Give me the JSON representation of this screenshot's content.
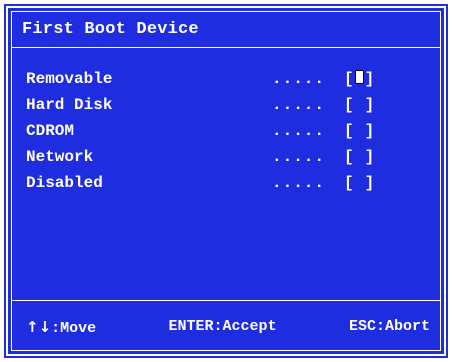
{
  "dialog": {
    "title": "First Boot Device"
  },
  "options": [
    {
      "label": "Removable",
      "dots": ".....",
      "selected": true
    },
    {
      "label": "Hard Disk",
      "dots": ".....",
      "selected": false
    },
    {
      "label": "CDROM",
      "dots": ".....",
      "selected": false
    },
    {
      "label": "Network",
      "dots": ".....",
      "selected": false
    },
    {
      "label": "Disabled",
      "dots": ".....",
      "selected": false
    }
  ],
  "footer": {
    "move_arrows": "↑↓",
    "move_label": ":Move",
    "enter_label": "ENTER:Accept",
    "esc_label": "ESC:Abort"
  },
  "colors": {
    "background": "#1f2de0",
    "text": "#ffffff"
  }
}
